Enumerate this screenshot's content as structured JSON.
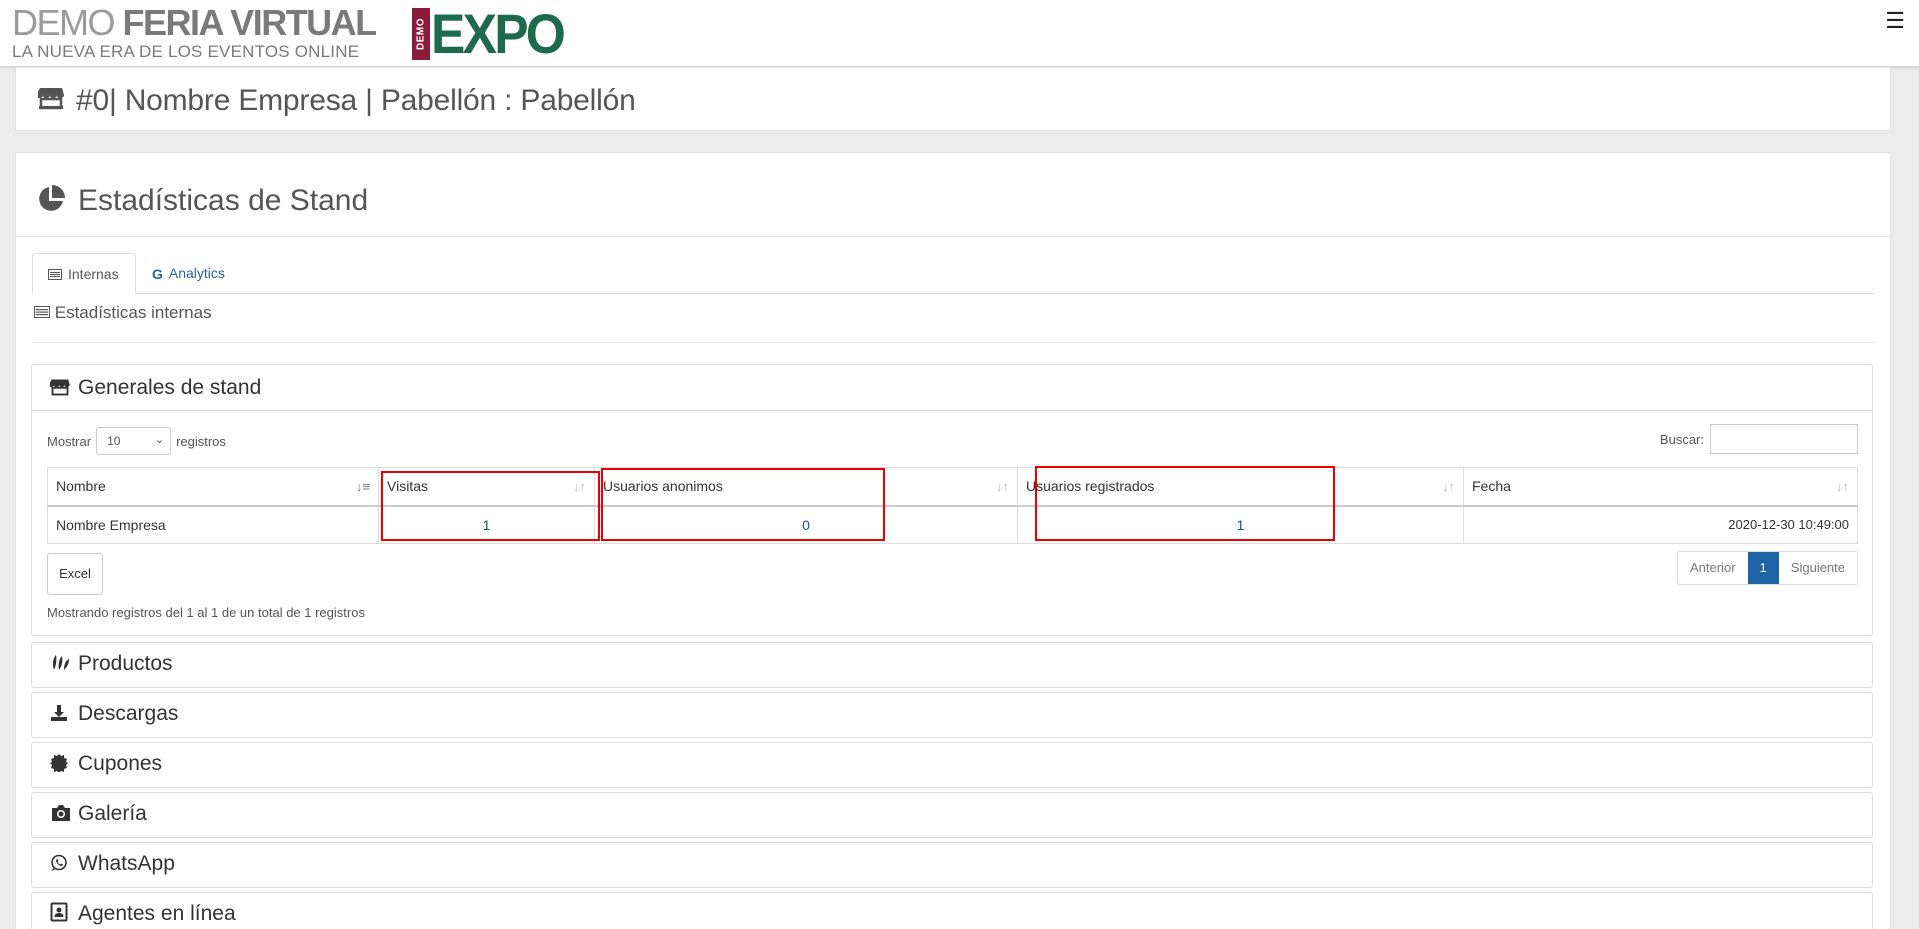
{
  "header": {
    "brand_light": "DEMO ",
    "brand_bold": "FERIA VIRTUAL",
    "brand_tagline": "LA NUEVA ERA DE LOS EVENTOS ONLINE",
    "logo_small": "DEMO",
    "logo_big": "EXPO",
    "menu_icon": "hamburger-icon"
  },
  "stand": {
    "title": "#0| Nombre Empresa | Pabellón : Pabellón",
    "icon": "store-icon"
  },
  "stats": {
    "title": "Estadísticas de Stand",
    "icon": "pie-chart-icon",
    "tabs": [
      {
        "label": "Internas",
        "icon": "list-icon",
        "active": true
      },
      {
        "label": "Analytics",
        "icon": "google-icon",
        "active": false
      }
    ],
    "internal_label": "Estadísticas internas"
  },
  "general": {
    "title": "Generales de stand",
    "show_prefix": "Mostrar",
    "show_value": "10",
    "show_suffix": "registros",
    "search_label": "Buscar:",
    "columns": [
      "Nombre",
      "Visitas",
      "Usuarios anonimos",
      "Usuarios registrados",
      "Fecha"
    ],
    "rows": [
      {
        "nombre": "Nombre Empresa",
        "visitas": "1",
        "anonimos": "0",
        "registrados": "1",
        "fecha": "2020-12-30 10:49:00"
      }
    ],
    "excel_label": "Excel",
    "pager": {
      "prev": "Anterior",
      "current": "1",
      "next": "Siguiente"
    },
    "info": "Mostrando registros del 1 al 1 de un total de 1 registros"
  },
  "sections": [
    {
      "label": "Productos",
      "icon": "leaf-icon"
    },
    {
      "label": "Descargas",
      "icon": "download-icon"
    },
    {
      "label": "Cupones",
      "icon": "badge-icon"
    },
    {
      "label": "Galería",
      "icon": "camera-icon"
    },
    {
      "label": "WhatsApp",
      "icon": "whatsapp-icon"
    },
    {
      "label": "Agentes en línea",
      "icon": "contact-card-icon"
    }
  ],
  "colors": {
    "accent": "#1d65a6",
    "brand_green": "#1d6b4c",
    "brand_red": "#8c1b3a",
    "highlight": "#e00000"
  }
}
